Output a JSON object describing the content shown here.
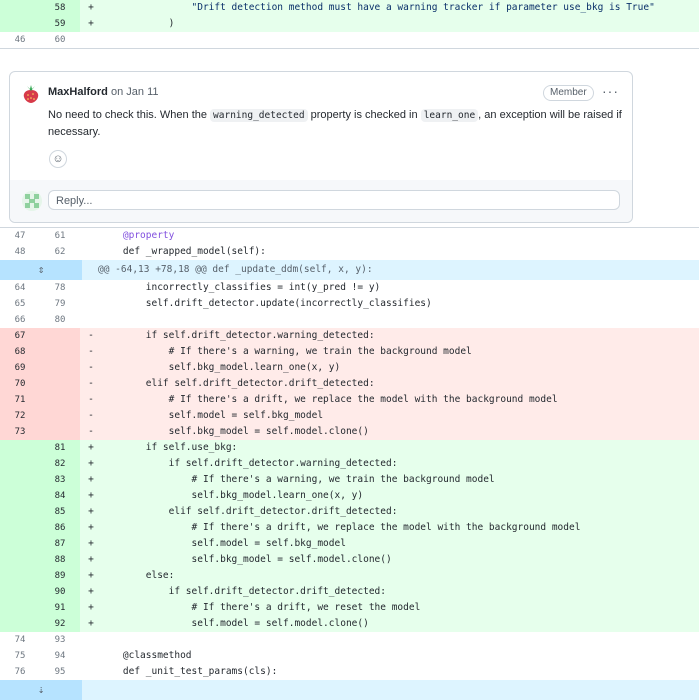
{
  "top_rows": [
    {
      "old": "",
      "new": "58",
      "type": "add",
      "code": "                \"Drift detection method must have a warning tracker if parameter use_bkg is True\""
    },
    {
      "old": "",
      "new": "59",
      "type": "add",
      "code": "            )"
    },
    {
      "old": "46",
      "new": "60",
      "type": "ctx",
      "code": ""
    }
  ],
  "comment": {
    "author": "MaxHalford",
    "date": "on Jan 11",
    "badge": "Member",
    "menu_glyph": "···",
    "text_before": "No need to check this. When the ",
    "code_1": "warning_detected",
    "text_middle": " property is checked in ",
    "code_2": "learn_one",
    "text_after": ", an exception will be raised if necessary.",
    "emoji_glyph": "☺",
    "reply_placeholder": "Reply..."
  },
  "mid_rows": [
    {
      "old": "47",
      "new": "61",
      "type": "ctx",
      "code": "    @property"
    },
    {
      "old": "48",
      "new": "62",
      "type": "ctx",
      "code": "    def _wrapped_model(self):"
    }
  ],
  "hunk": {
    "header": "@@ -64,13 +78,18 @@ def _update_ddm(self, x, y):",
    "expand_glyph": "⇕"
  },
  "main_rows": [
    {
      "old": "64",
      "new": "78",
      "type": "ctx",
      "sign": "",
      "code": "        incorrectly_classifies = int(y_pred != y)"
    },
    {
      "old": "65",
      "new": "79",
      "type": "ctx",
      "sign": "",
      "code": "        self.drift_detector.update(incorrectly_classifies)"
    },
    {
      "old": "66",
      "new": "80",
      "type": "ctx",
      "sign": "",
      "code": ""
    },
    {
      "old": "67",
      "new": "",
      "type": "del",
      "sign": "-",
      "code": "        if self.drift_detector.warning_detected:"
    },
    {
      "old": "68",
      "new": "",
      "type": "del",
      "sign": "-",
      "code": "            # If there's a warning, we train the background model"
    },
    {
      "old": "69",
      "new": "",
      "type": "del",
      "sign": "-",
      "code": "            self.bkg_model.learn_one(x, y)"
    },
    {
      "old": "70",
      "new": "",
      "type": "del",
      "sign": "-",
      "code": "        elif self.drift_detector.drift_detected:"
    },
    {
      "old": "71",
      "new": "",
      "type": "del",
      "sign": "-",
      "code": "            # If there's a drift, we replace the model with the background model"
    },
    {
      "old": "72",
      "new": "",
      "type": "del",
      "sign": "-",
      "code": "            self.model = self.bkg_model"
    },
    {
      "old": "73",
      "new": "",
      "type": "del",
      "sign": "-",
      "code": "            self.bkg_model = self.model.clone()"
    },
    {
      "old": "",
      "new": "81",
      "type": "add",
      "sign": "+",
      "code": "        if self.use_bkg:"
    },
    {
      "old": "",
      "new": "82",
      "type": "add",
      "sign": "+",
      "code": "            if self.drift_detector.warning_detected:"
    },
    {
      "old": "",
      "new": "83",
      "type": "add",
      "sign": "+",
      "code": "                # If there's a warning, we train the background model"
    },
    {
      "old": "",
      "new": "84",
      "type": "add",
      "sign": "+",
      "code": "                self.bkg_model.learn_one(x, y)"
    },
    {
      "old": "",
      "new": "85",
      "type": "add",
      "sign": "+",
      "code": "            elif self.drift_detector.drift_detected:"
    },
    {
      "old": "",
      "new": "86",
      "type": "add",
      "sign": "+",
      "code": "                # If there's a drift, we replace the model with the background model"
    },
    {
      "old": "",
      "new": "87",
      "type": "add",
      "sign": "+",
      "code": "                self.model = self.bkg_model"
    },
    {
      "old": "",
      "new": "88",
      "type": "add",
      "sign": "+",
      "code": "                self.bkg_model = self.model.clone()"
    },
    {
      "old": "",
      "new": "89",
      "type": "add",
      "sign": "+",
      "code": "        else:"
    },
    {
      "old": "",
      "new": "90",
      "type": "add",
      "sign": "+",
      "code": "            if self.drift_detector.drift_detected:"
    },
    {
      "old": "",
      "new": "91",
      "type": "add",
      "sign": "+",
      "code": "                # If there's a drift, we reset the model"
    },
    {
      "old": "",
      "new": "92",
      "type": "add",
      "sign": "+",
      "code": "                self.model = self.model.clone()"
    },
    {
      "old": "74",
      "new": "93",
      "type": "ctx",
      "sign": "",
      "code": ""
    },
    {
      "old": "75",
      "new": "94",
      "type": "ctx",
      "sign": "",
      "code": "    @classmethod"
    },
    {
      "old": "76",
      "new": "95",
      "type": "ctx",
      "sign": "",
      "code": "    def _unit_test_params(cls):"
    }
  ],
  "bottom_expand_glyph": "⇣"
}
